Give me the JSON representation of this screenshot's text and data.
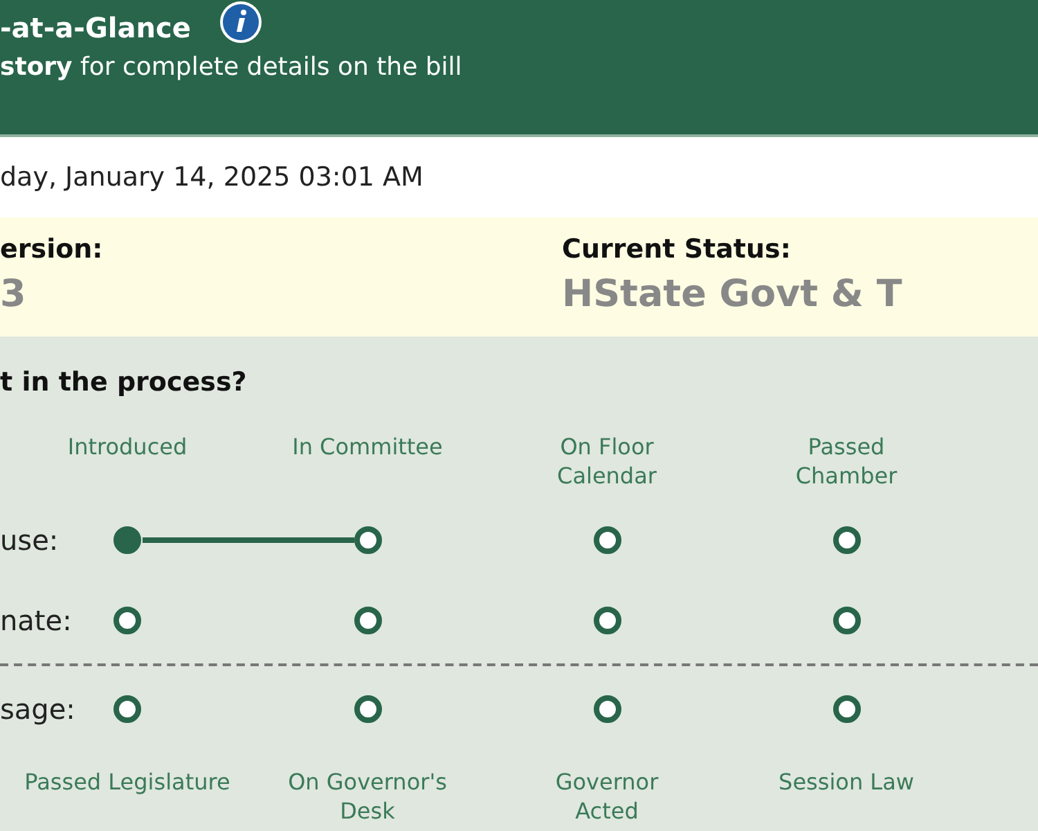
{
  "header": {
    "title": "-at-a-Glance",
    "subtitle": "**story** for complete details on the bill"
  },
  "updated": "day, January 14, 2025 03:01 AM",
  "summary": [
    {
      "label": "ersion:",
      "value": "3"
    },
    {
      "label": "Current Status:",
      "value": "HState Govt & T"
    }
  ],
  "process": {
    "heading": "t in the process?",
    "stages": [
      "Introduced",
      "In Committee",
      "On Floor Calendar",
      "Passed Chamber"
    ],
    "rows": [
      {
        "label": "use:",
        "nodes": [
          {
            "filled": true,
            "linked": false
          },
          {
            "filled": false,
            "linked": true
          },
          {
            "filled": false,
            "linked": false
          },
          {
            "filled": false,
            "linked": false
          }
        ]
      },
      {
        "label": "nate:",
        "nodes": [
          {
            "filled": false,
            "linked": false
          },
          {
            "filled": false,
            "linked": false
          },
          {
            "filled": false,
            "linked": false
          },
          {
            "filled": false,
            "linked": false
          }
        ]
      }
    ],
    "passage": {
      "label": "sage:",
      "nodes": [
        {
          "filled": false,
          "linked": false
        },
        {
          "filled": false,
          "linked": false
        },
        {
          "filled": false,
          "linked": false
        },
        {
          "filled": false,
          "linked": false
        }
      ]
    },
    "final_stages": [
      "Passed Legislature",
      "On Governor's Desk",
      "Governor Acted",
      "Session Law"
    ]
  }
}
